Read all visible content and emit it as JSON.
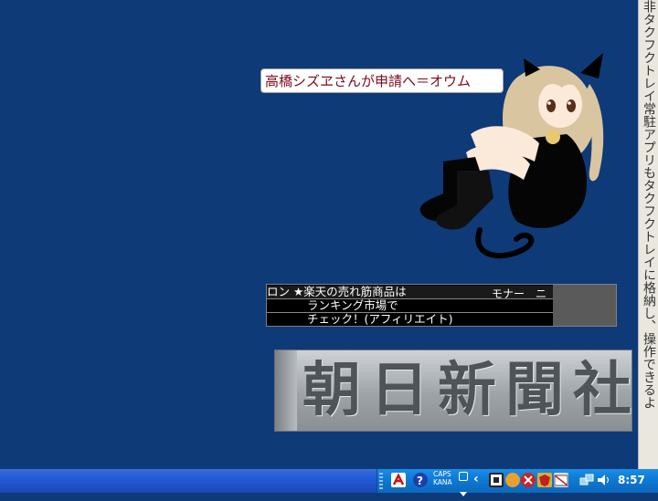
{
  "desktop": {
    "background": "#0e3a78"
  },
  "vertical_ticker": {
    "text": "非タクフクトレイ常駐アプリもタクフクトレイに格納し、操作できるよ"
  },
  "speech_bubble": {
    "text": "高橋シズヱさんが申請へ＝オウム"
  },
  "news_ticker": {
    "line1": "ロン ★楽天の売れ筋商品は",
    "line1_right": "モナー　ニ",
    "line2": "ランキング市場で",
    "line3": "チェック！(アフィリエイト)"
  },
  "banner": {
    "text": "朝日新聞社"
  },
  "taskbar": {
    "caps_label": "CAPS",
    "kana_label": "KANA",
    "chevron": "‹",
    "clock": "8:57"
  },
  "icons": [
    "acrobat-icon",
    "help-icon",
    "ime-icon",
    "security-icon",
    "shield-icon",
    "network-icon",
    "speaker-icon"
  ]
}
